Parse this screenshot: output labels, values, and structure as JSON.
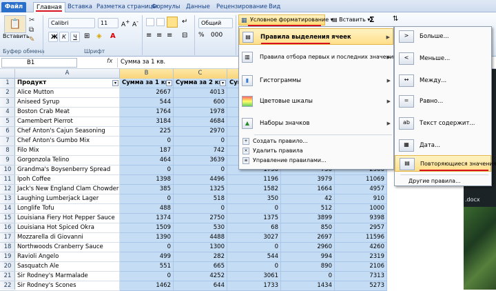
{
  "tabs": [
    "Файл",
    "Главная",
    "Вставка",
    "Разметка страницы",
    "Формулы",
    "Данные",
    "Рецензирование",
    "Вид"
  ],
  "ribbon": {
    "paste_label": "Вставить",
    "font_name": "Calibri",
    "font_size": "11",
    "number_format": "Общий",
    "cond_format_label": "Условное форматирование",
    "insert_label": "Вставить",
    "sigma": "Σ",
    "groups": {
      "clipboard": "Буфер обмена",
      "font": "Шрифт"
    },
    "bold": "Ж",
    "italic": "К",
    "underline": "Ч",
    "percent": "%"
  },
  "formula_bar": {
    "name_box": "B1",
    "fx": "fx",
    "content": "Сумма за 1 кв."
  },
  "columns": [
    "A",
    "B",
    "C"
  ],
  "rows": [
    {
      "n": "1",
      "a": "Продукт",
      "b": "Сумма за 1 кв.",
      "c": "Сумма за 2 кв.",
      "d": "Сум",
      "e": "",
      "f": ""
    },
    {
      "n": "2",
      "a": "Alice Mutton",
      "b": "2667",
      "c": "4013",
      "d": "",
      "e": "",
      "f": ""
    },
    {
      "n": "3",
      "a": "Aniseed Syrup",
      "b": "544",
      "c": "600",
      "d": "",
      "e": "",
      "f": ""
    },
    {
      "n": "4",
      "a": "Boston Crab Meat",
      "b": "1764",
      "c": "1978",
      "d": "",
      "e": "",
      "f": ""
    },
    {
      "n": "5",
      "a": "Camembert Pierrot",
      "b": "3184",
      "c": "4684",
      "d": "",
      "e": "",
      "f": ""
    },
    {
      "n": "6",
      "a": "Chef Anton's Cajun Seasoning",
      "b": "225",
      "c": "2970",
      "d": "",
      "e": "",
      "f": ""
    },
    {
      "n": "7",
      "a": "Chef Anton's Gumbo Mix",
      "b": "0",
      "c": "0",
      "d": "",
      "e": "",
      "f": ""
    },
    {
      "n": "8",
      "a": "Filo Mix",
      "b": "187",
      "c": "742",
      "d": "",
      "e": "",
      "f": ""
    },
    {
      "n": "9",
      "a": "Gorgonzola Telino",
      "b": "464",
      "c": "3639",
      "d": "",
      "e": "",
      "f": ""
    },
    {
      "n": "10",
      "a": "Grandma's Boysenberry Spread",
      "b": "0",
      "c": "0",
      "d": "1750",
      "e": "750",
      "f": "2500"
    },
    {
      "n": "11",
      "a": "Ipoh Coffee",
      "b": "1398",
      "c": "4496",
      "d": "1196",
      "e": "3979",
      "f": "11069"
    },
    {
      "n": "12",
      "a": "Jack's New England Clam Chowder",
      "b": "385",
      "c": "1325",
      "d": "1582",
      "e": "1664",
      "f": "4957"
    },
    {
      "n": "13",
      "a": "Laughing Lumberjack Lager",
      "b": "0",
      "c": "518",
      "d": "350",
      "e": "42",
      "f": "910"
    },
    {
      "n": "14",
      "a": "Longlife Tofu",
      "b": "488",
      "c": "0",
      "d": "0",
      "e": "512",
      "f": "1000"
    },
    {
      "n": "15",
      "a": "Louisiana Fiery Hot Pepper Sauce",
      "b": "1374",
      "c": "2750",
      "d": "1375",
      "e": "3899",
      "f": "9398"
    },
    {
      "n": "16",
      "a": "Louisiana Hot Spiced Okra",
      "b": "1509",
      "c": "530",
      "d": "68",
      "e": "850",
      "f": "2957"
    },
    {
      "n": "17",
      "a": "Mozzarella di Giovanni",
      "b": "1390",
      "c": "4488",
      "d": "3027",
      "e": "2697",
      "f": "11596"
    },
    {
      "n": "18",
      "a": "Northwoods Cranberry Sauce",
      "b": "0",
      "c": "1300",
      "d": "0",
      "e": "2960",
      "f": "4260"
    },
    {
      "n": "19",
      "a": "Ravioli Angelo",
      "b": "499",
      "c": "282",
      "d": "544",
      "e": "994",
      "f": "2319"
    },
    {
      "n": "20",
      "a": "Sasquatch Ale",
      "b": "551",
      "c": "665",
      "d": "0",
      "e": "890",
      "f": "2106"
    },
    {
      "n": "21",
      "a": "Sir Rodney's Marmalade",
      "b": "0",
      "c": "4252",
      "d": "3061",
      "e": "0",
      "f": "7313"
    },
    {
      "n": "22",
      "a": "Sir Rodney's Scones",
      "b": "1462",
      "c": "644",
      "d": "1733",
      "e": "1434",
      "f": "5273"
    }
  ],
  "cf_menu": {
    "items": [
      {
        "label": "Правила выделения ячеек",
        "icon": "highlight-rules-icon",
        "highlighted": true
      },
      {
        "label": "Правила отбора первых и последних значений",
        "icon": "top-bottom-icon"
      },
      {
        "label": "Гистограммы",
        "icon": "databars-icon"
      },
      {
        "label": "Цветовые шкалы",
        "icon": "colorscales-icon"
      },
      {
        "label": "Наборы значков",
        "icon": "iconsets-icon"
      }
    ],
    "small_items": [
      "Создать правило...",
      "Удалить правила",
      "Управление правилами..."
    ]
  },
  "submenu": {
    "items": [
      "Больше...",
      "Меньше...",
      "Между...",
      "Равно...",
      "Текст содержит...",
      "Дата...",
      "Повторяющиеся значения..."
    ],
    "footer": "Другие правила..."
  },
  "taskbar_text": ".docx",
  "colors": {
    "selection": "#c4dcf4",
    "accent_red": "#d9101f",
    "menu_highlight": "#ffdf8a"
  }
}
